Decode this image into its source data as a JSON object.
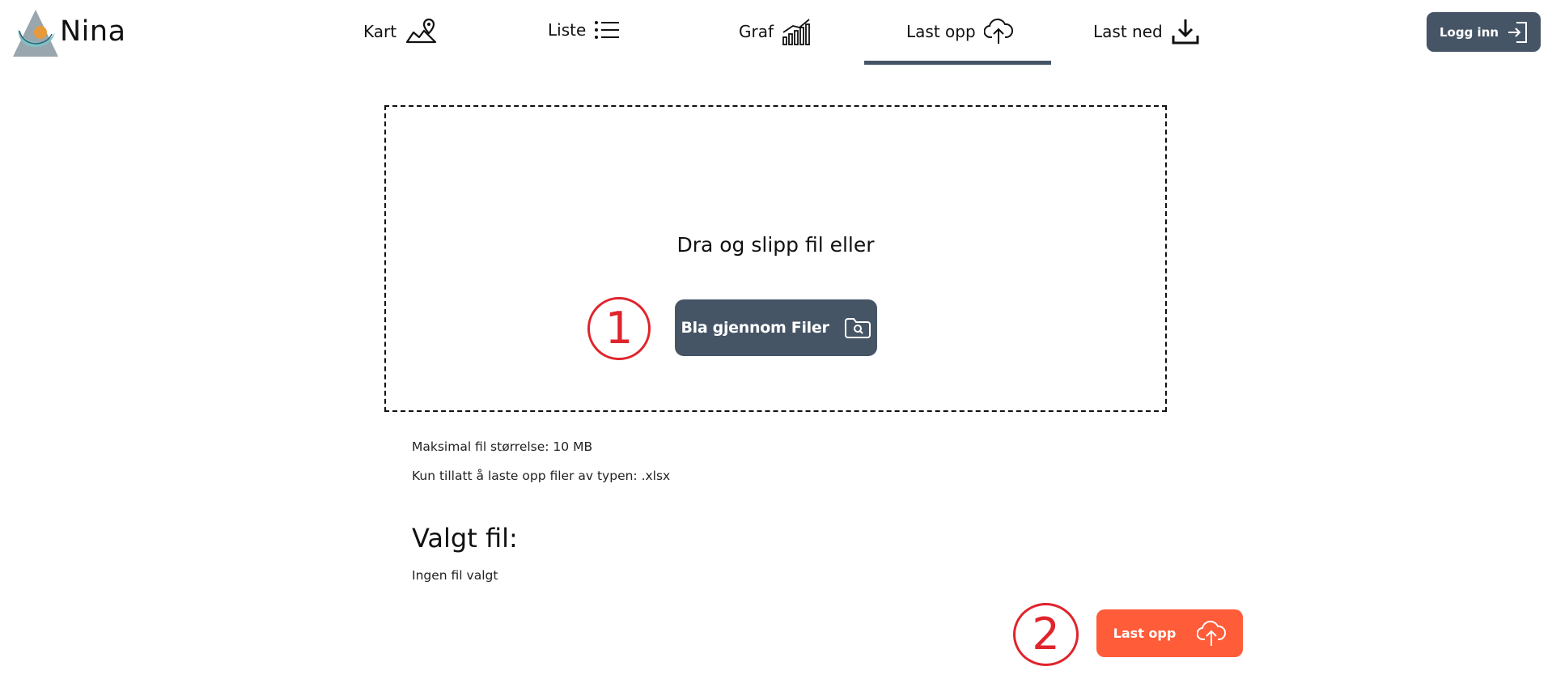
{
  "brand": {
    "name": "Nina"
  },
  "nav": {
    "items": [
      {
        "label": "Kart",
        "icon": "map-pin-icon"
      },
      {
        "label": "Liste",
        "icon": "list-icon"
      },
      {
        "label": "Graf",
        "icon": "bar-chart-icon"
      },
      {
        "label": "Last opp",
        "icon": "cloud-upload-icon",
        "active": true
      },
      {
        "label": "Last ned",
        "icon": "download-icon"
      }
    ]
  },
  "header": {
    "login_label": "Logg inn",
    "login_icon": "sign-in-icon"
  },
  "upload": {
    "drop_text": "Dra og slipp fil eller",
    "browse_label": "Bla gjennom Filer",
    "browse_icon": "folder-search-icon",
    "max_size": "Maksimal fil størrelse: 10 MB",
    "allowed_types": "Kun tillatt å laste opp filer av typen: .xlsx",
    "selected_heading": "Valgt fil:",
    "selected_value": "Ingen fil valgt",
    "submit_label": "Last opp",
    "submit_icon": "cloud-upload-icon"
  },
  "annotations": {
    "step1": "1",
    "step2": "2"
  },
  "colors": {
    "primary": "#465566",
    "accent": "#ff5c3a",
    "annotation": "#e0242c"
  }
}
